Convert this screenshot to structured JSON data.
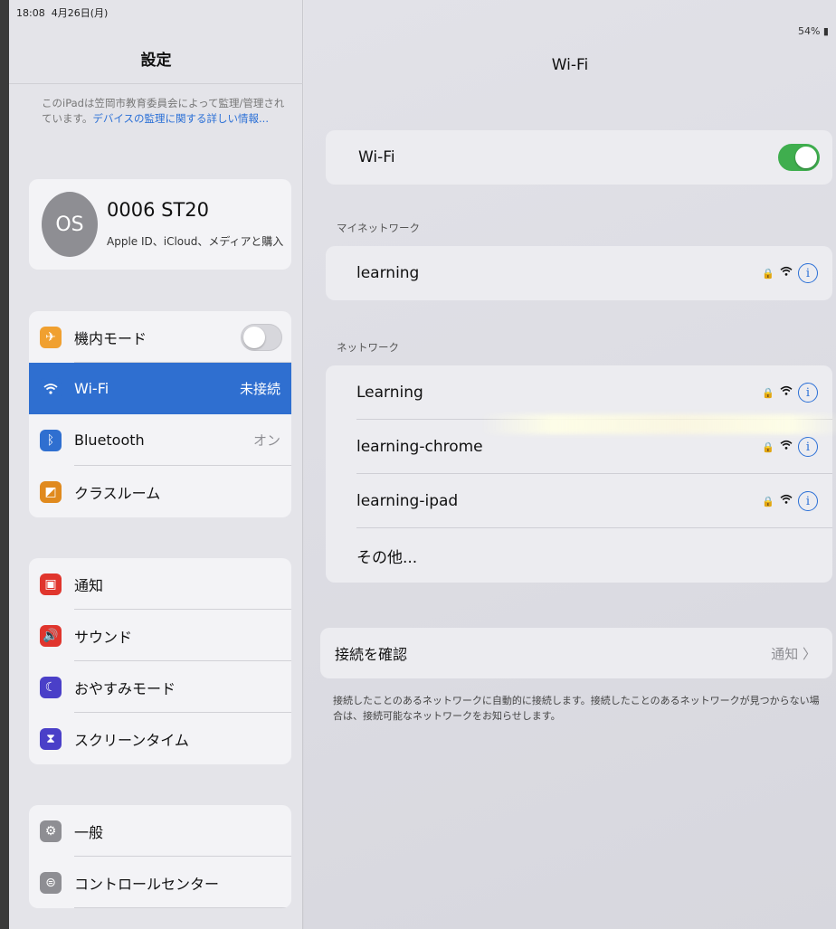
{
  "status": {
    "time": "18:08",
    "date": "4月26日(月)",
    "battery": "54%"
  },
  "sidebar": {
    "title": "設定",
    "supervision_text": "このiPadは笠岡市教育委員会によって監理/管理されています。",
    "supervision_link": "デバイスの監理に関する詳しい情報...",
    "profile": {
      "initials": "OS",
      "name": "0006 ST20",
      "subtitle": "Apple ID、iCloud、メディアと購入"
    },
    "connectivity": [
      {
        "label": "機内モード",
        "icon": "airplane-icon",
        "color": "#f0a030",
        "value": "",
        "toggle": "off"
      },
      {
        "label": "Wi-Fi",
        "icon": "wifi-icon",
        "color": "#2f6fd0",
        "value": "未接続",
        "selected": true
      },
      {
        "label": "Bluetooth",
        "icon": "bluetooth-icon",
        "color": "#2f6fd0",
        "value": "オン"
      },
      {
        "label": "クラスルーム",
        "icon": "classroom-icon",
        "color": "#e08a1e",
        "value": ""
      }
    ],
    "notifications": [
      {
        "label": "通知",
        "icon": "notifications-icon",
        "color": "#e0352d"
      },
      {
        "label": "サウンド",
        "icon": "sound-icon",
        "color": "#e0352d"
      },
      {
        "label": "おやすみモード",
        "icon": "moon-icon",
        "color": "#4a3fc8"
      },
      {
        "label": "スクリーンタイム",
        "icon": "hourglass-icon",
        "color": "#4a3fc8"
      }
    ],
    "general": [
      {
        "label": "一般",
        "icon": "gear-icon",
        "color": "#8e8e93"
      },
      {
        "label": "コントロールセンター",
        "icon": "control-center-icon",
        "color": "#8e8e93"
      }
    ]
  },
  "main": {
    "title": "Wi-Fi",
    "wifi_label": "Wi-Fi",
    "wifi_toggle": "on",
    "my_networks_header": "マイネットワーク",
    "my_networks": [
      {
        "name": "learning"
      }
    ],
    "networks_header": "ネットワーク",
    "networks": [
      {
        "name": "Learning"
      },
      {
        "name": "learning-chrome"
      },
      {
        "name": "learning-ipad"
      }
    ],
    "other_label": "その他...",
    "ask_join_label": "接続を確認",
    "ask_join_value": "通知 〉",
    "footnote": "接続したことのあるネットワークに自動的に接続します。接続したことのあるネットワークが見つからない場合は、接続可能なネットワークをお知らせします。"
  }
}
